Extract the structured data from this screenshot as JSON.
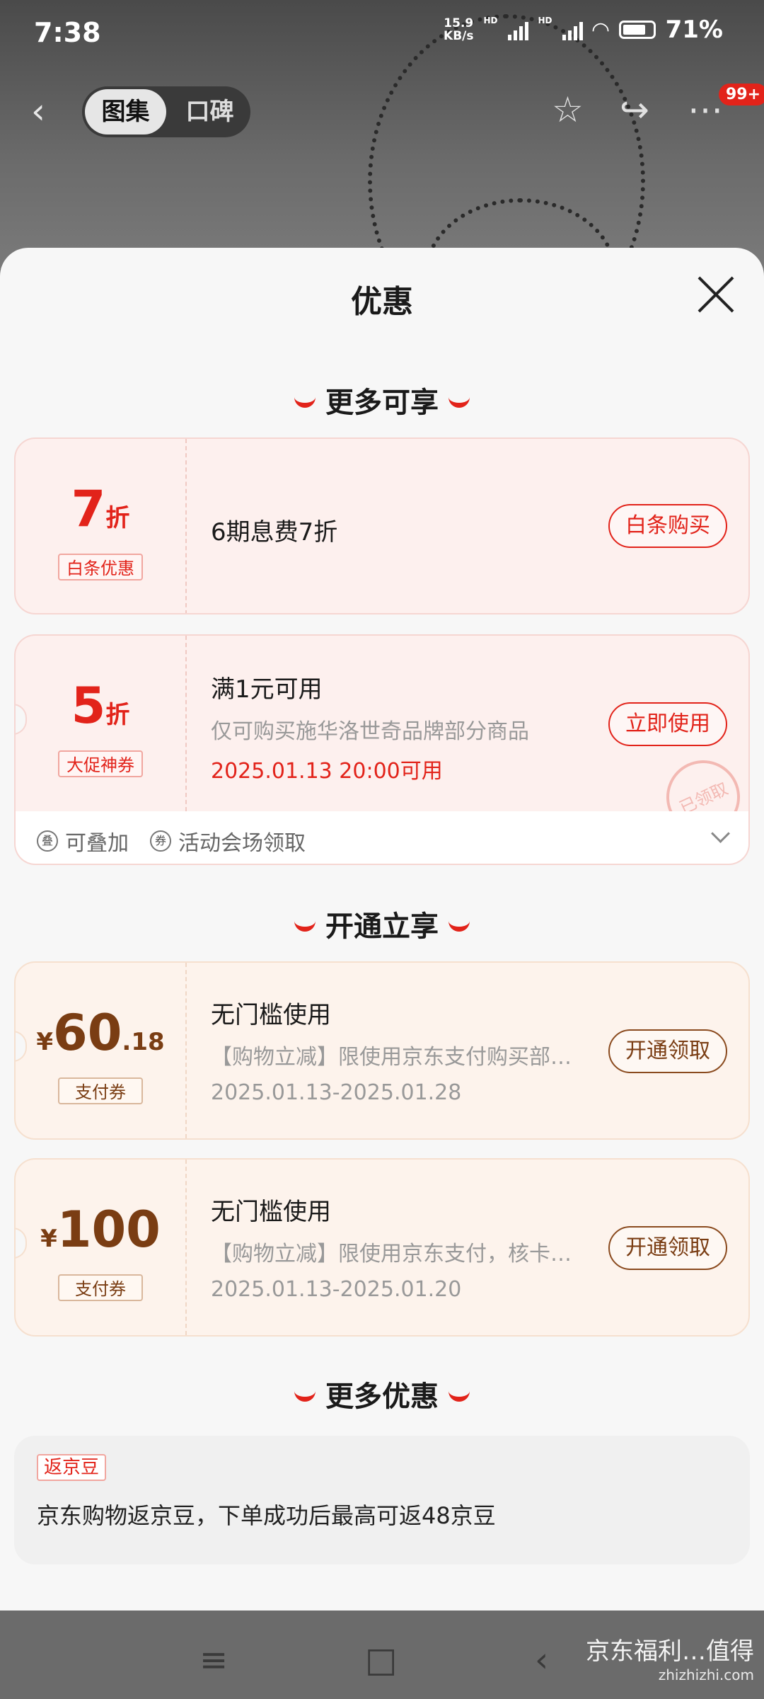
{
  "status_bar": {
    "time": "7:38",
    "net_speed_value": "15.9",
    "net_speed_unit": "KB/s",
    "hd1": "HD",
    "hd2": "HD",
    "battery": "71%"
  },
  "header": {
    "tabs": [
      "图集",
      "口碑"
    ],
    "active_tab": "图集",
    "badge": "99+"
  },
  "sheet": {
    "title": "优惠",
    "sections": {
      "more": "更多可享",
      "open": "开通立享",
      "more_offers": "更多优惠"
    },
    "cards": [
      {
        "discount_num": "7",
        "discount_unit": "折",
        "tag": "白条优惠",
        "title": "6期息费7折",
        "button": "白条购买"
      },
      {
        "discount_num": "5",
        "discount_unit": "折",
        "tag": "大促神券",
        "title": "满1元可用",
        "desc": "仅可购买施华洛世奇品牌部分商品",
        "date": "2025.01.13 20:00可用",
        "button": "立即使用",
        "stamp": "已领取",
        "meta1": "可叠加",
        "meta2": "活动会场领取"
      },
      {
        "currency": "¥",
        "amount_int": "60",
        "amount_dec": ".18",
        "tag": "支付券",
        "title": "无门槛使用",
        "desc": "【购物立减】限使用京东支付购买部…",
        "date": "2025.01.13-2025.01.28",
        "button": "开通领取"
      },
      {
        "currency": "¥",
        "amount_int": "100",
        "amount_dec": "",
        "tag": "支付券",
        "title": "无门槛使用",
        "desc": "【购物立减】限使用京东支付，核卡…",
        "date": "2025.01.13-2025.01.20",
        "button": "开通领取"
      }
    ],
    "bean": {
      "tag": "返京豆",
      "text": "京东购物返京豆，下单成功后最高可返48京豆"
    }
  },
  "watermark": {
    "line1": "京东福利…值得",
    "line2": "zhizhizhi.com"
  },
  "colors": {
    "accent": "#e2231a",
    "gold": "#7a3d13"
  }
}
